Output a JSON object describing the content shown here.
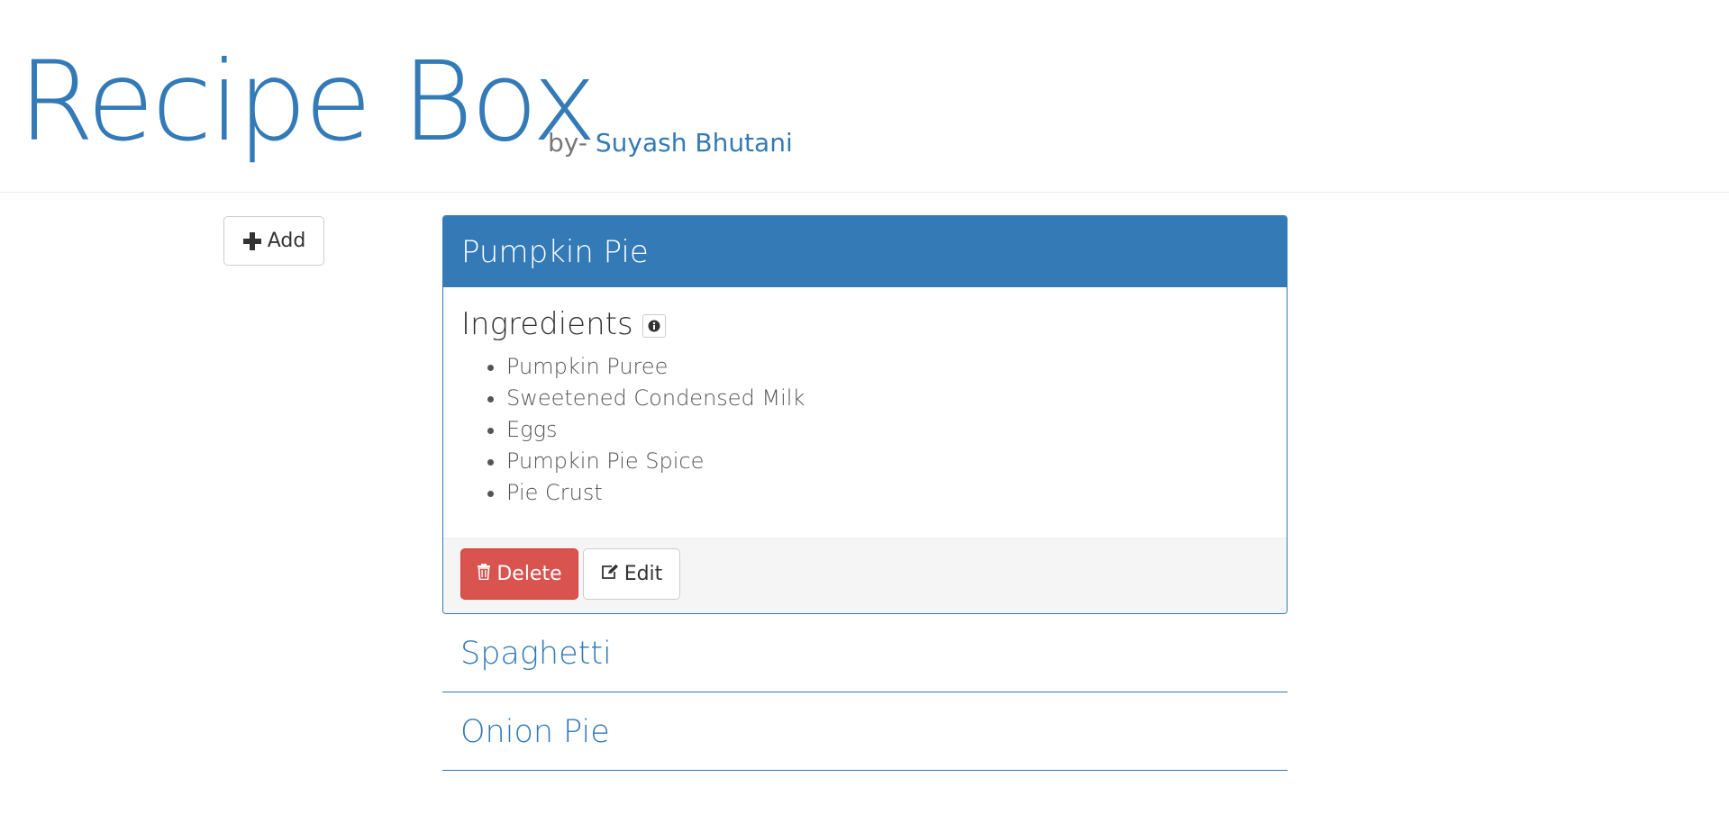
{
  "header": {
    "title": "Recipe Box",
    "by_label": "by-",
    "author": "Suyash Bhutani"
  },
  "toolbar": {
    "add_label": "Add",
    "add_icon": "plus-icon"
  },
  "recipes": [
    {
      "name": "Pumpkin Pie",
      "expanded": true,
      "ingredients_label": "Ingredients",
      "ingredients": [
        "Pumpkin Puree",
        "Sweetened Condensed Milk",
        "Eggs",
        "Pumpkin Pie Spice",
        "Pie Crust"
      ],
      "delete_label": "Delete",
      "edit_label": "Edit"
    },
    {
      "name": "Spaghetti",
      "expanded": false
    },
    {
      "name": "Onion Pie",
      "expanded": false
    }
  ],
  "colors": {
    "primary": "#337ab7",
    "danger": "#d9534f",
    "footer_bg": "#f5f5f5"
  }
}
